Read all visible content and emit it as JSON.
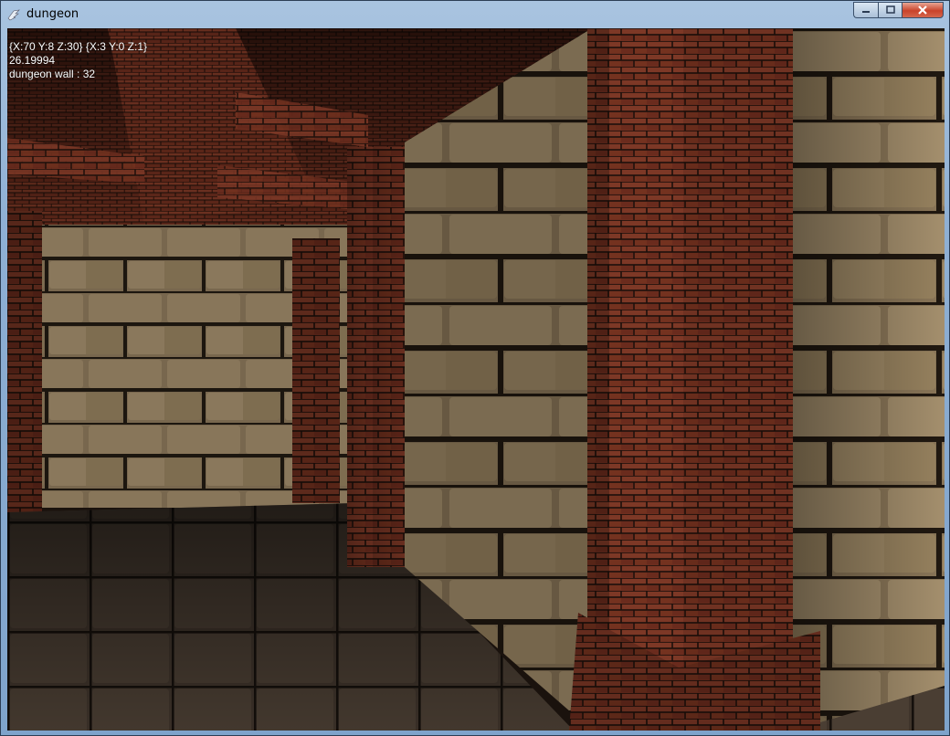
{
  "window": {
    "title": "dungeon",
    "app_icon": "wing-icon",
    "controls": {
      "minimize_icon": "minimize-icon",
      "maximize_icon": "maximize-icon",
      "close_icon": "close-icon"
    }
  },
  "hud": {
    "coords": "{X:70 Y:8 Z:30} {X:3 Y:0 Z:1}",
    "fps": "26.19994",
    "target": "dungeon wall : 32"
  },
  "scene": {
    "brick_color": "#6e2e1f",
    "stone_color": "#9a8463",
    "floor_color": "#3d3128",
    "mortar_color": "#1a1410"
  }
}
